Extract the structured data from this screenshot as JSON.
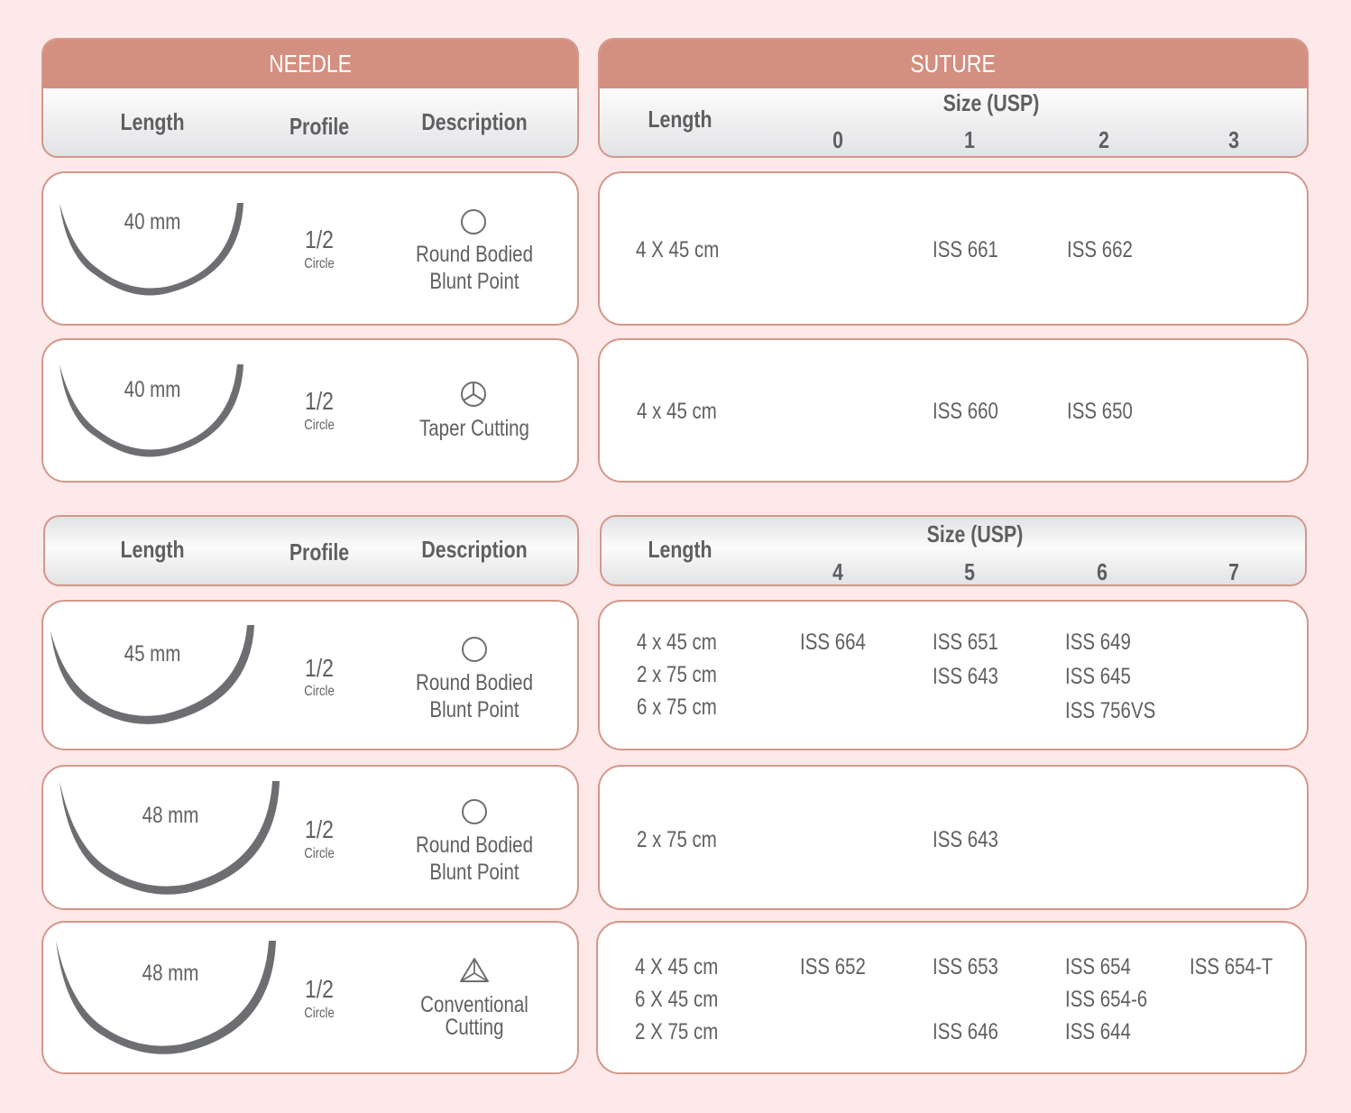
{
  "colors": {
    "background": "#fde9e9",
    "header_band": "#d38f80",
    "border": "#d4978a",
    "text": "#5f6062",
    "needle": "#6d6e71"
  },
  "needle_header": {
    "title": "NEEDLE",
    "columns": [
      "Length",
      "Profile",
      "Description"
    ]
  },
  "suture_header": {
    "title": "SUTURE",
    "length_label": "Length",
    "size_label": "Size (USP)",
    "sizes": [
      "0",
      "1",
      "2",
      "3"
    ]
  },
  "needle_header_2": {
    "columns": [
      "Length",
      "Profile",
      "Description"
    ]
  },
  "suture_header_2": {
    "length_label": "Length",
    "size_label": "Size (USP)",
    "sizes": [
      "4",
      "5",
      "6",
      "7"
    ]
  },
  "rows": [
    {
      "needle": {
        "length": "40 mm",
        "profile": "1/2",
        "profile_sub": "Circle",
        "icon": "round-bodied-icon",
        "description": [
          "Round Bodied",
          "Blunt Point"
        ]
      },
      "suture": {
        "lengths": [
          "4 X 45 cm"
        ],
        "cells": [
          [
            "",
            "ISS 661",
            "ISS 662",
            ""
          ]
        ]
      }
    },
    {
      "needle": {
        "length": "40 mm",
        "profile": "1/2",
        "profile_sub": "Circle",
        "icon": "taper-cutting-icon",
        "description": [
          "Taper Cutting"
        ]
      },
      "suture": {
        "lengths": [
          "4 x 45 cm"
        ],
        "cells": [
          [
            "",
            "ISS 660",
            "ISS 650",
            ""
          ]
        ]
      }
    },
    {
      "needle": {
        "length": "45 mm",
        "profile": "1/2",
        "profile_sub": "Circle",
        "icon": "round-bodied-icon",
        "description": [
          "Round Bodied",
          "Blunt Point"
        ]
      },
      "suture": {
        "lengths": [
          "4 x 45 cm",
          "2 x 75 cm",
          "6 x 75 cm"
        ],
        "cells": [
          [
            "ISS 664",
            "ISS 651",
            "ISS 649",
            ""
          ],
          [
            "",
            "ISS 643",
            "ISS 645",
            ""
          ],
          [
            "",
            "",
            "ISS 756VS",
            ""
          ]
        ]
      }
    },
    {
      "needle": {
        "length": "48 mm",
        "profile": "1/2",
        "profile_sub": "Circle",
        "icon": "round-bodied-icon",
        "description": [
          "Round Bodied",
          "Blunt Point"
        ]
      },
      "suture": {
        "lengths": [
          "2 x 75 cm"
        ],
        "cells": [
          [
            "",
            "ISS 643",
            "",
            ""
          ]
        ]
      }
    },
    {
      "needle": {
        "length": "48 mm",
        "profile": "1/2",
        "profile_sub": "Circle",
        "icon": "conventional-cutting-icon",
        "description": [
          "Conventional",
          "Cutting"
        ]
      },
      "suture": {
        "lengths": [
          "4 X 45 cm",
          "6 X 45 cm",
          "2 X 75 cm"
        ],
        "cells": [
          [
            "ISS 652",
            "ISS 653",
            "ISS 654",
            "ISS 654-T"
          ],
          [
            "",
            "",
            "ISS 654-6",
            ""
          ],
          [
            "",
            "ISS 646",
            "ISS 644",
            ""
          ]
        ]
      }
    }
  ]
}
